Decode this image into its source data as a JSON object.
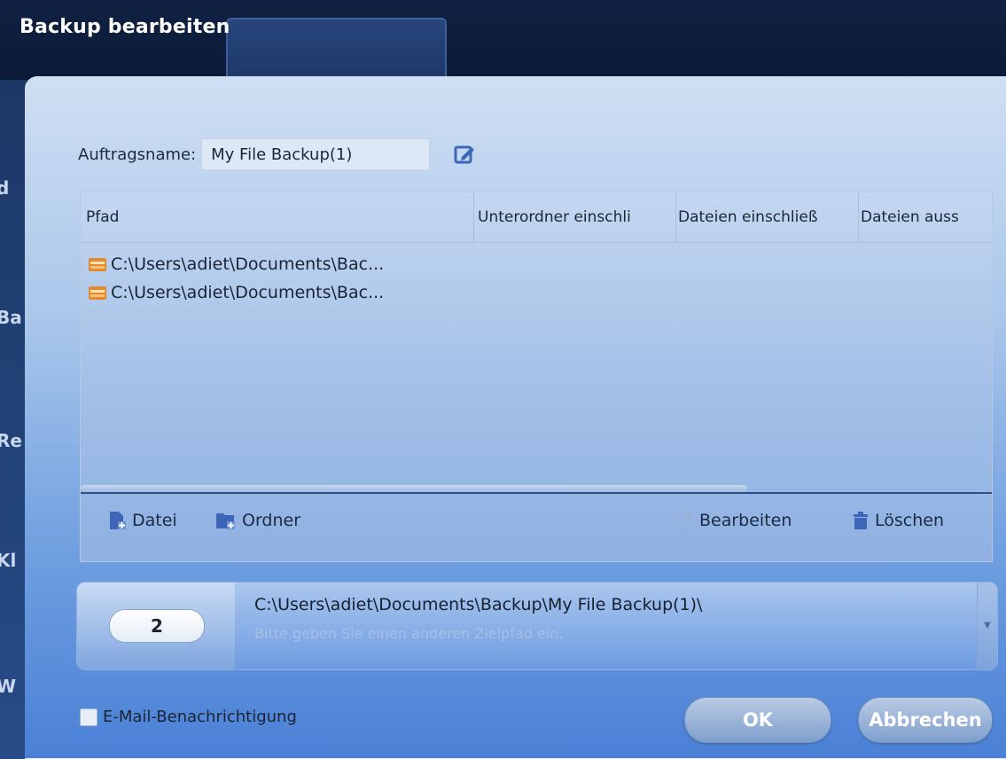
{
  "window": {
    "title": "Backup bearbeiten",
    "side_fragments": [
      "d",
      "Ba",
      "Re",
      "Kl",
      "W"
    ]
  },
  "dialog": {
    "task_name_label": "Auftragsname:",
    "task_name_value": "My File Backup(1)",
    "table": {
      "columns": [
        "Pfad",
        "Unterordner einschli",
        "Dateien einschließ",
        "Dateien auss"
      ],
      "rows": [
        {
          "path": "C:\\Users\\adiet\\Documents\\Bac..."
        },
        {
          "path": "C:\\Users\\adiet\\Documents\\Bac..."
        }
      ]
    },
    "toolbar": {
      "file": "Datei",
      "folder": "Ordner",
      "edit": "Bearbeiten",
      "delete": "Löschen"
    },
    "destination": {
      "step": "2",
      "path": "C:\\Users\\adiet\\Documents\\Backup\\My File Backup(1)\\",
      "hint": "Bitte geben Sie einen anderen Zielpfad ein."
    },
    "email_label": "E-Mail-Benachrichtigung",
    "ok_label": "OK",
    "cancel_label": "Abbrechen"
  },
  "colors": {
    "dialog_top": "#cfdff3",
    "dialog_bottom": "#4a80d6",
    "window_dark": "#0e1a33",
    "icon_blue": "#3e66b8",
    "folder_orange": "#e38b2c"
  },
  "icons": {
    "edit_name": "edit-icon",
    "row": "folder-icon",
    "file": "add-file-icon",
    "folder": "add-folder-icon",
    "edit": "edit-icon",
    "delete": "trash-icon",
    "dropdown": "chevron-down-icon"
  }
}
